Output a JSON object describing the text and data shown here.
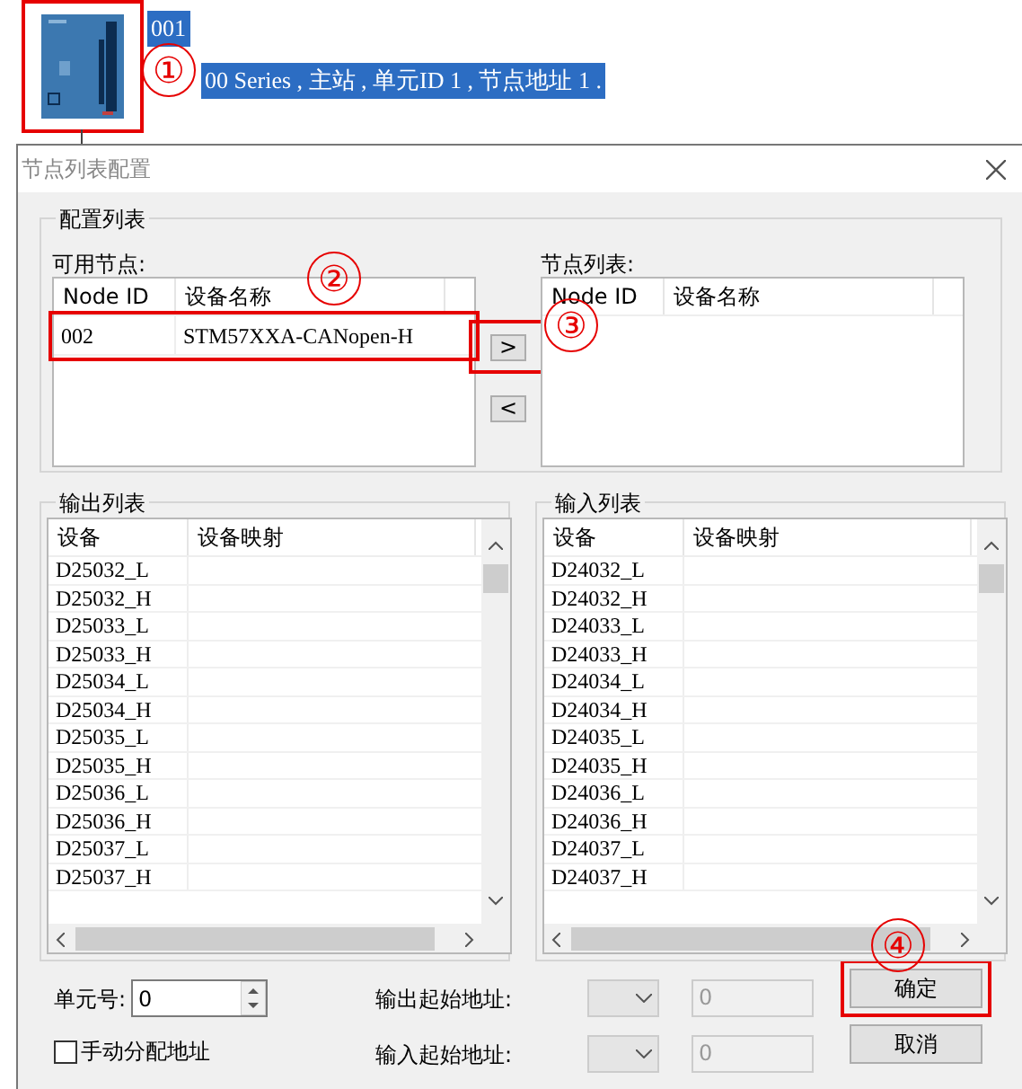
{
  "device": {
    "id_label": "001",
    "description": "00 Series , 主站 , 单元ID 1 , 节点地址 1 .",
    "selected": true,
    "highlighted": true
  },
  "dialog": {
    "title": "节点列表配置"
  },
  "config": {
    "title": "配置列表",
    "available": {
      "label": "可用节点:",
      "columns": [
        "Node ID",
        "设备名称"
      ],
      "rows": [
        {
          "cells": [
            "002",
            "STM57XXA-CANopen-H"
          ],
          "highlighted": true
        }
      ]
    },
    "add_button": {
      "label": ">",
      "highlighted": true
    },
    "remove_button": {
      "label": "<",
      "highlighted": false
    },
    "node_list": {
      "label": "节点列表:",
      "columns": [
        "Node ID",
        "设备名称"
      ]
    }
  },
  "output_list": {
    "title": "输出列表",
    "columns": [
      "设备",
      "设备映射"
    ],
    "rows": [
      "D25032_L",
      "D25032_H",
      "D25033_L",
      "D25033_H",
      "D25034_L",
      "D25034_H",
      "D25035_L",
      "D25035_H",
      "D25036_L",
      "D25036_H",
      "D25037_L",
      "D25037_H"
    ]
  },
  "input_list": {
    "title": "输入列表",
    "columns": [
      "设备",
      "设备映射"
    ],
    "rows": [
      "D24032_L",
      "D24032_H",
      "D24033_L",
      "D24033_H",
      "D24034_L",
      "D24034_H",
      "D24035_L",
      "D24035_H",
      "D24036_L",
      "D24036_H",
      "D24037_L",
      "D24037_H"
    ]
  },
  "unit": {
    "label": "单元号:",
    "value": "0"
  },
  "manual_address": {
    "label": "手动分配地址",
    "checked": false
  },
  "addresses": [
    {
      "label": "输出起始地址:",
      "value": "0",
      "disabled": true
    },
    {
      "label": "输入起始地址:",
      "value": "0",
      "disabled": true
    }
  ],
  "ok_button": {
    "label": "确定",
    "highlighted": true
  },
  "cancel_button": {
    "label": "取消",
    "highlighted": false
  },
  "callouts": [
    "①",
    "②",
    "③",
    "④"
  ]
}
